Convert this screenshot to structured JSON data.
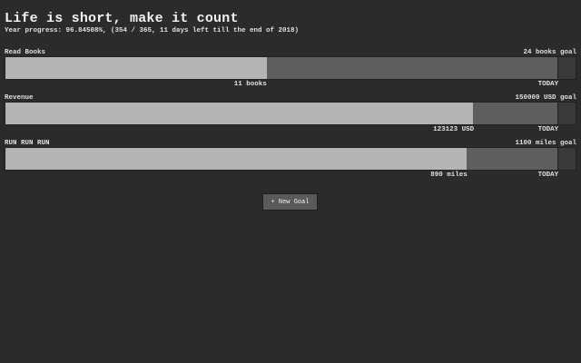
{
  "header": {
    "title": "Life is short, make it count",
    "subtitle": "Year progress: 96.84508%, (354 / 365, 11 days left till the end of 2018)"
  },
  "year_progress_fraction": 0.9685,
  "goals": [
    {
      "name": "Read Books",
      "target_label": "24 books goal",
      "value_label": "11 books",
      "today_label": "TODAY",
      "current": 11,
      "target": 24
    },
    {
      "name": "Revenue",
      "target_label": "150000 USD goal",
      "value_label": "123123 USD",
      "today_label": "TODAY",
      "current": 123123,
      "target": 150000
    },
    {
      "name": "RUN RUN RUN",
      "target_label": "1100 miles goal",
      "value_label": "890 miles",
      "today_label": "TODAY",
      "current": 890,
      "target": 1100
    }
  ],
  "new_goal_button": {
    "label": "+ New Goal"
  },
  "colors": {
    "background": "#2b2b2b",
    "completed": "#b4b4b4",
    "elapsed": "#5e5e5e",
    "remaining": "#3a3a3a"
  }
}
